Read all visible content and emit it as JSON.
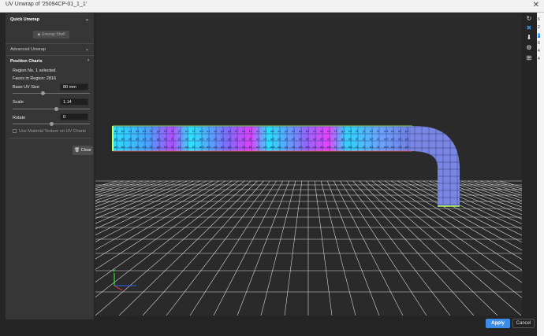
{
  "window": {
    "title": "UV Unwrap of '25094CP-01_1_1'"
  },
  "panel": {
    "quick_unwrap": {
      "title": "Quick Unwrap",
      "unwrap_shell_label": "Unwrap Shell"
    },
    "advanced_unwrap": {
      "title": "Advanced Unwrap"
    },
    "position_charts": {
      "title": "Position Charts",
      "region_selected": "Region No. 1 selected.",
      "faces_in_region": "Faces in Region: 2816",
      "base_uv_size": {
        "label": "Base UV Size",
        "value": "80 mm",
        "slider_fraction": 0.4
      },
      "scale": {
        "label": "Scale",
        "value": "1.14",
        "slider_fraction": 0.5
      },
      "rotate": {
        "label": "Rotate",
        "value": "0",
        "slider_fraction": 0.5
      },
      "use_material_texture": {
        "label": "Use Material Texture on UV Charts",
        "checked": false
      }
    },
    "clear_label": "Clear"
  },
  "viewport": {
    "tile_labels": [
      "a",
      "b",
      "c",
      "d",
      "e",
      "f",
      "g",
      "h",
      "i",
      "j",
      "k",
      "l",
      "m",
      "n",
      "o",
      "p",
      "q",
      "r",
      "s",
      "t",
      "u",
      "v",
      "w",
      "x",
      "y",
      "z"
    ],
    "tile_rows": [
      "1",
      "2",
      "3",
      "4",
      "5",
      "6",
      "7"
    ]
  },
  "right_toolbar": {
    "icons": [
      "refresh-icon",
      "fit-view-icon",
      "download-icon",
      "settings-icon",
      "grid-toggle-icon"
    ]
  },
  "background_strip": [
    "6",
    "2",
    "7",
    "6",
    "4",
    "4"
  ],
  "footer": {
    "apply_label": "Apply",
    "cancel_label": "Cancel"
  },
  "colors": {
    "accent": "#3c8ce6",
    "panel": "#363636",
    "viewport": "#2a2a2a"
  }
}
